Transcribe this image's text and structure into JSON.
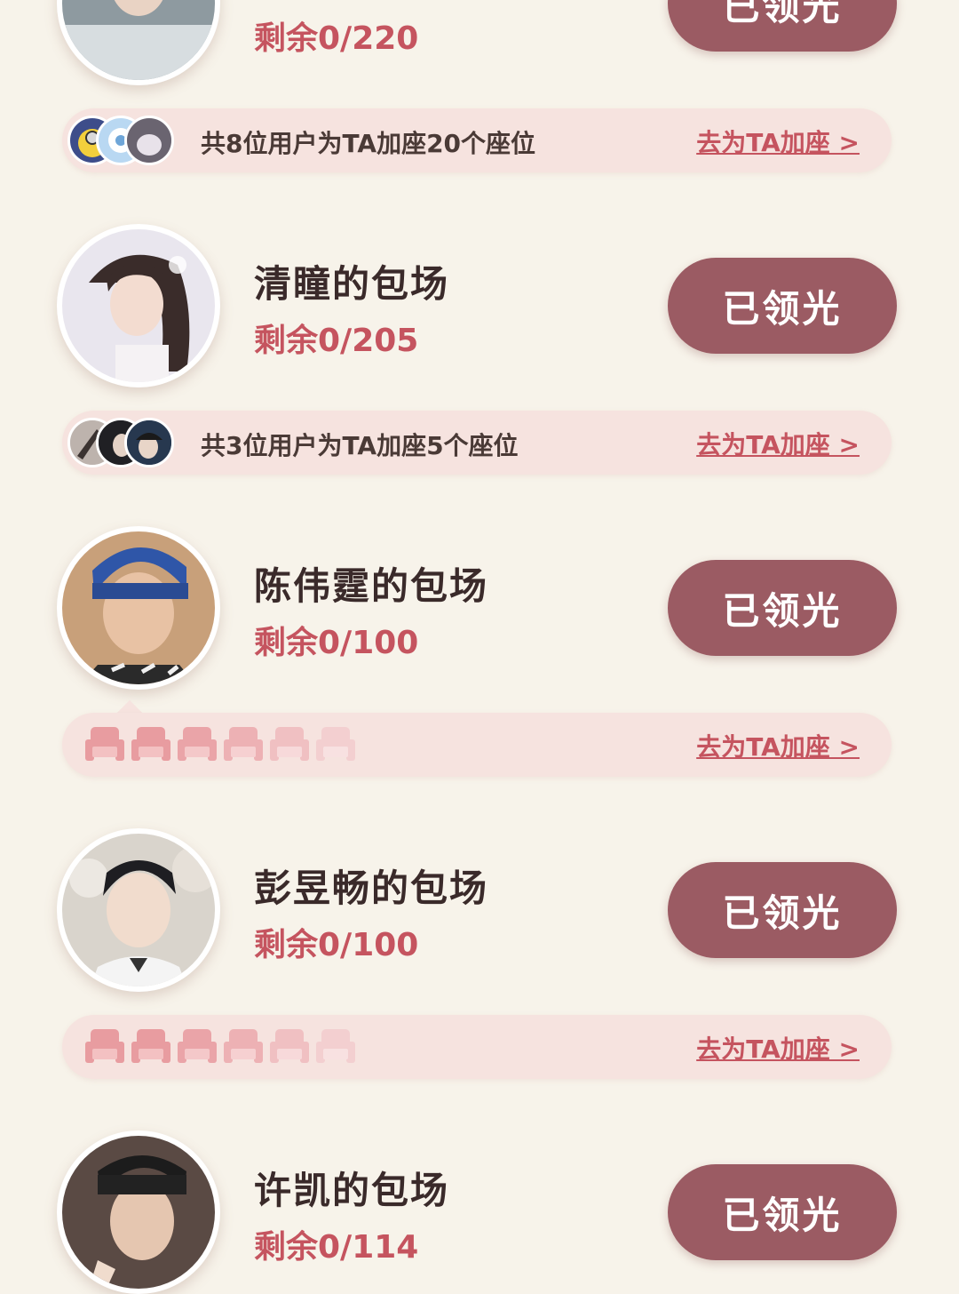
{
  "colors": {
    "accent": "#c5545f",
    "button": "#9b5b63",
    "bar": "#f6e3df",
    "background": "#f7f3ea"
  },
  "entries": [
    {
      "name": "",
      "remaining": "剩余0/220",
      "button": "已领光",
      "support_text": "共8位用户为TA加座20个座位",
      "support_link": "去为TA加座 >"
    },
    {
      "name": "清瞳的包场",
      "remaining": "剩余0/205",
      "button": "已领光",
      "support_text": "共3位用户为TA加座5个座位",
      "support_link": "去为TA加座 >"
    },
    {
      "name": "陈伟霆的包场",
      "remaining": "剩余0/100",
      "button": "已领光",
      "support_text": "",
      "support_link": "去为TA加座 >"
    },
    {
      "name": "彭昱畅的包场",
      "remaining": "剩余0/100",
      "button": "已领光",
      "support_text": "",
      "support_link": "去为TA加座 >"
    },
    {
      "name": "许凯的包场",
      "remaining": "剩余0/114",
      "button": "已领光"
    }
  ]
}
